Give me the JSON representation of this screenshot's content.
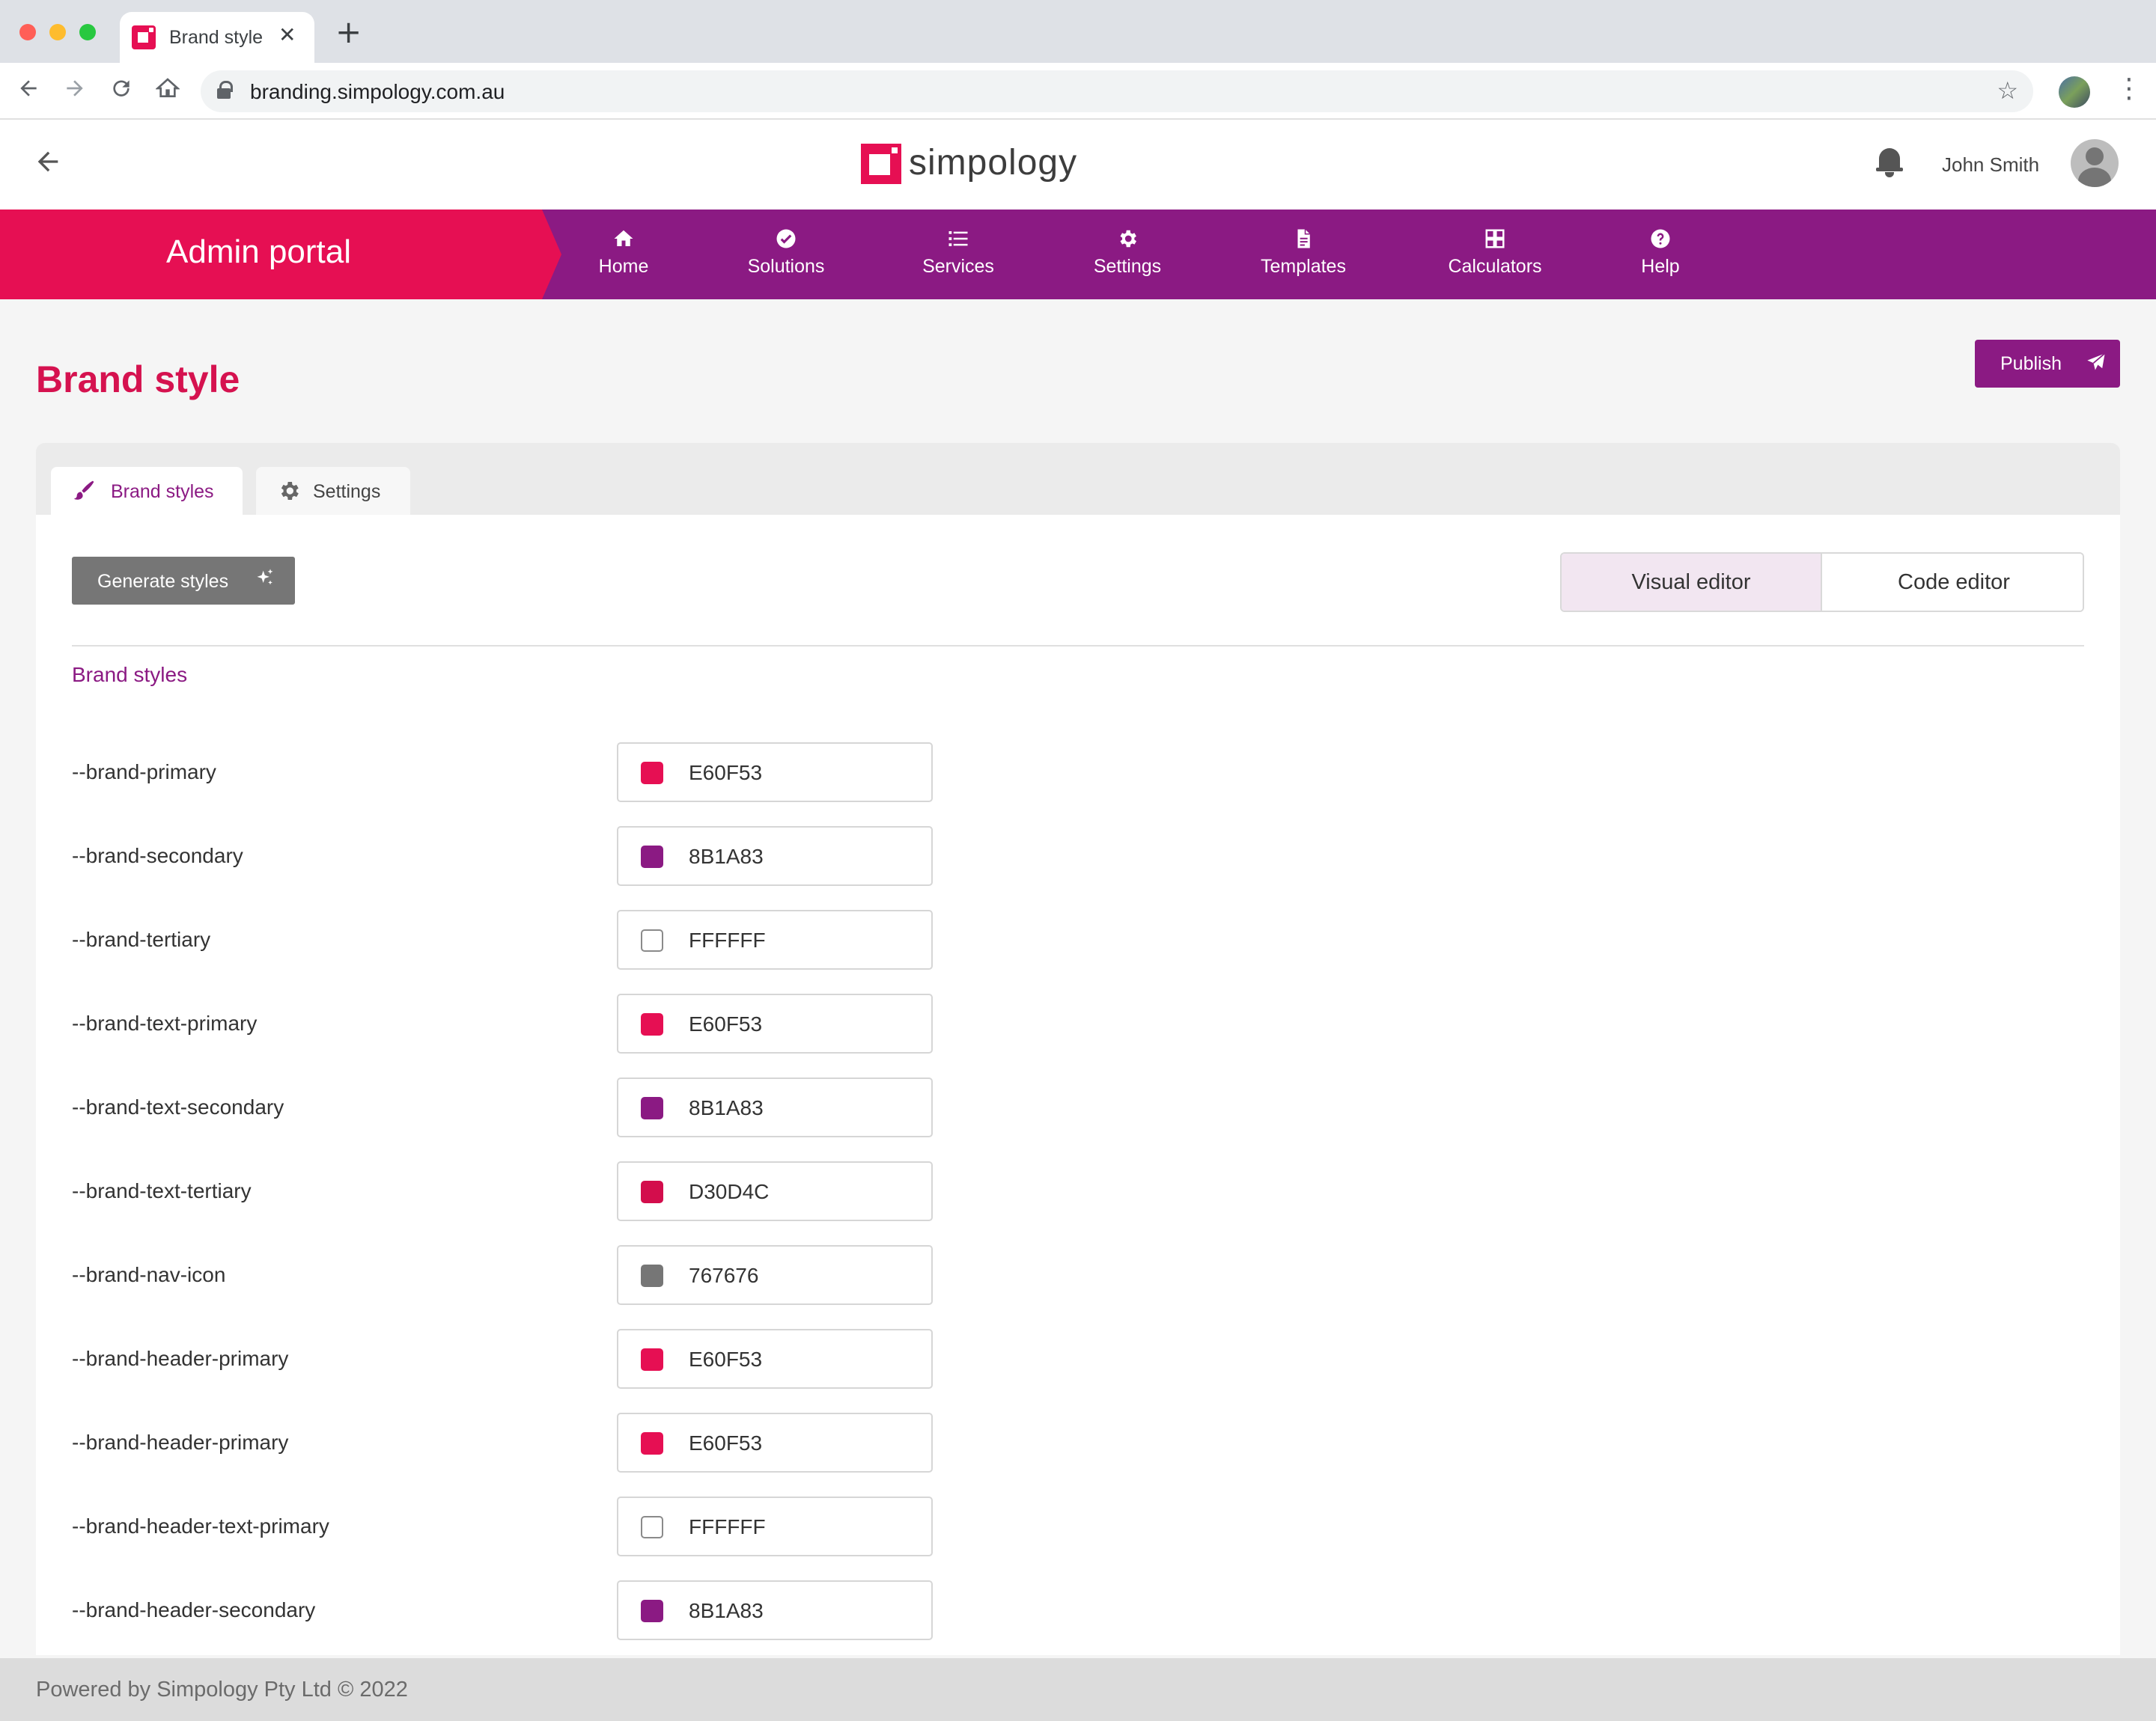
{
  "browser": {
    "tab_title": "Brand style",
    "tab_close": "✕",
    "new_tab": "+",
    "url": "branding.simpology.com.au"
  },
  "header": {
    "logo_text": "simpology",
    "user_name": "John Smith"
  },
  "nav": {
    "portal_title": "Admin portal",
    "items": [
      {
        "label": "Home",
        "icon": "home-icon"
      },
      {
        "label": "Solutions",
        "icon": "check-circle-icon"
      },
      {
        "label": "Services",
        "icon": "list-icon"
      },
      {
        "label": "Settings",
        "icon": "gear-icon"
      },
      {
        "label": "Templates",
        "icon": "document-icon"
      },
      {
        "label": "Calculators",
        "icon": "grid-icon"
      },
      {
        "label": "Help",
        "icon": "help-icon"
      }
    ]
  },
  "page": {
    "title": "Brand style",
    "publish_label": "Publish"
  },
  "tabs": {
    "brand_styles": "Brand styles",
    "settings": "Settings"
  },
  "toolbar": {
    "generate_label": "Generate styles",
    "visual_editor": "Visual editor",
    "code_editor": "Code editor",
    "active_editor": "Visual editor"
  },
  "section": {
    "title": "Brand styles"
  },
  "styles": [
    {
      "name": "--brand-primary",
      "hex": "E60F53",
      "color": "#E60F53"
    },
    {
      "name": "--brand-secondary",
      "hex": "8B1A83",
      "color": "#8B1A83"
    },
    {
      "name": "--brand-tertiary",
      "hex": "FFFFFF",
      "color": "#FFFFFF"
    },
    {
      "name": "--brand-text-primary",
      "hex": "E60F53",
      "color": "#E60F53"
    },
    {
      "name": "--brand-text-secondary",
      "hex": "8B1A83",
      "color": "#8B1A83"
    },
    {
      "name": "--brand-text-tertiary",
      "hex": "D30D4C",
      "color": "#D30D4C"
    },
    {
      "name": "--brand-nav-icon",
      "hex": "767676",
      "color": "#767676"
    },
    {
      "name": "--brand-header-primary",
      "hex": "E60F53",
      "color": "#E60F53"
    },
    {
      "name": "--brand-header-primary",
      "hex": "E60F53",
      "color": "#E60F53"
    },
    {
      "name": "--brand-header-text-primary",
      "hex": "FFFFFF",
      "color": "#FFFFFF"
    },
    {
      "name": "--brand-header-secondary",
      "hex": "8B1A83",
      "color": "#8B1A83"
    }
  ],
  "footer": {
    "text": "Powered by Simpology Pty Ltd © 2022"
  },
  "colors": {
    "brand_primary": "#E60F53",
    "brand_secondary": "#8B1A83",
    "page_title": "#D5124F",
    "nav_icon": "#767676"
  }
}
